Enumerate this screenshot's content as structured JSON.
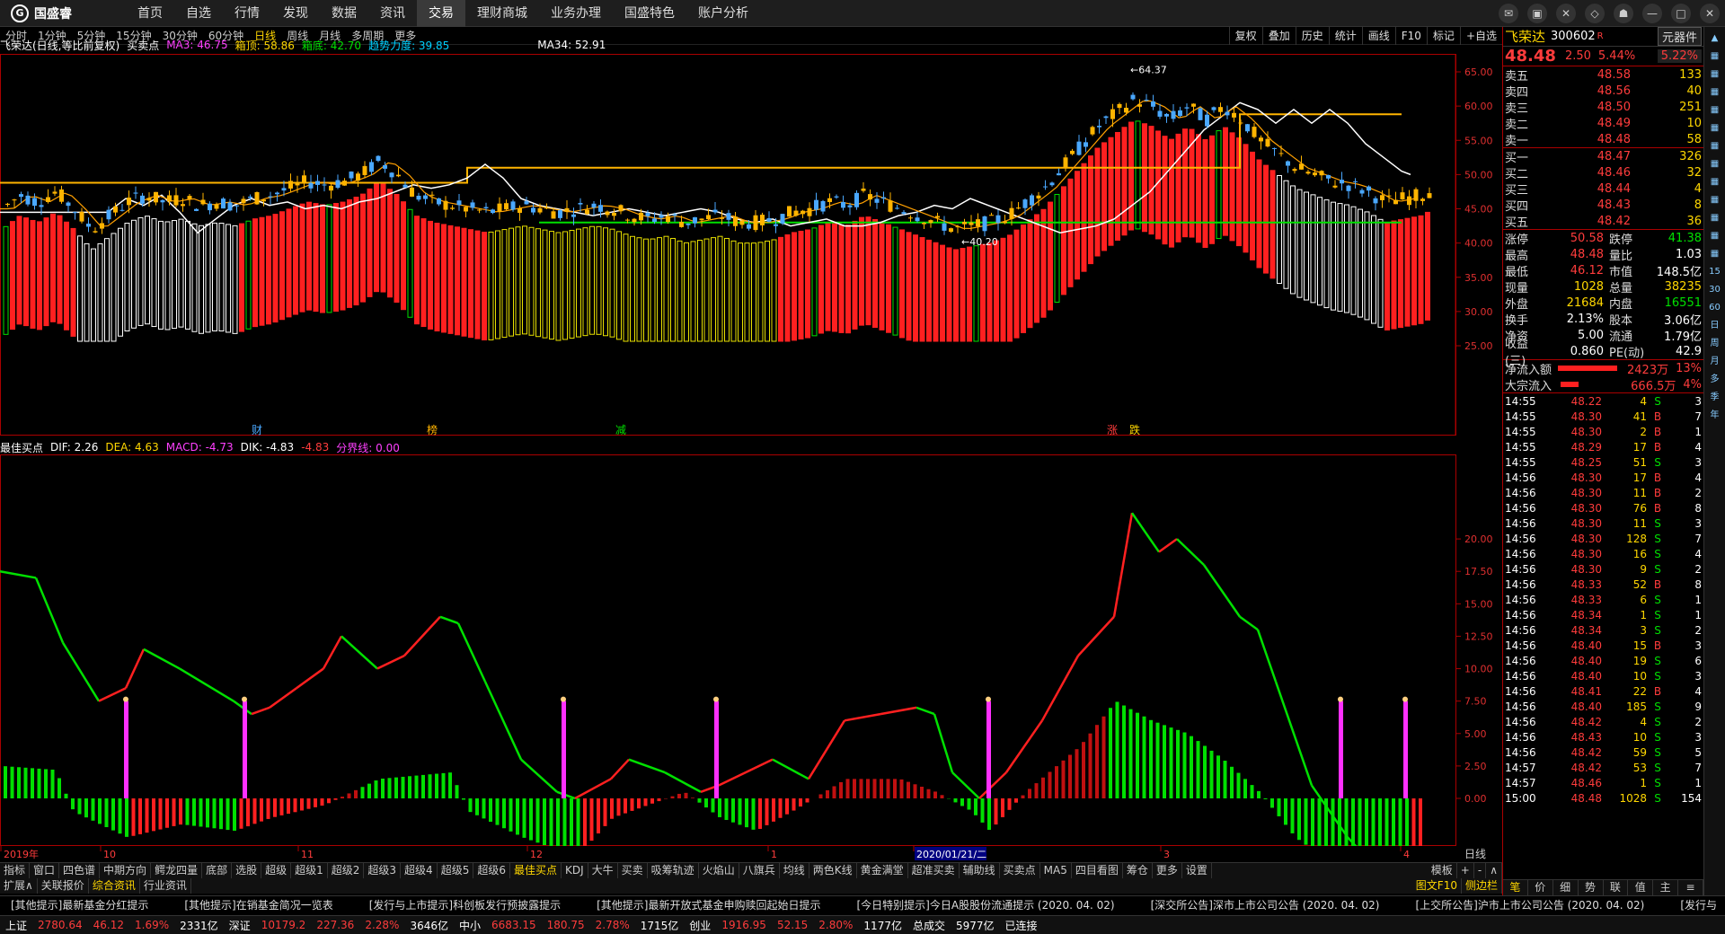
{
  "app": {
    "logo": "国盛睿"
  },
  "menu": [
    "首页",
    "自选",
    "行情",
    "发现",
    "数据",
    "资讯",
    "交易",
    "理财商城",
    "业务办理",
    "国盛特色",
    "账户分析"
  ],
  "menu_active": "交易",
  "periods": [
    "分时",
    "1分钟",
    "5分钟",
    "15分钟",
    "30分钟",
    "60分钟",
    "日线",
    "周线",
    "月线",
    "多周期",
    "更多"
  ],
  "period_active": "日线",
  "chart_tools": [
    "复权",
    "叠加",
    "历史",
    "统计",
    "画线",
    "F10",
    "标记",
    "+自选"
  ],
  "main_indicator": {
    "title": "飞荣达(日线,等比前复权)",
    "name": "买卖点",
    "ma3": "MA3: 46.75",
    "box_top": "箱顶: 58.86",
    "box_bottom": "箱底: 42.70",
    "trend": "趋势力度: 39.85",
    "ma34": "MA34: 52.91"
  },
  "price_axis": [
    "65.00",
    "60.00",
    "55.00",
    "50.00",
    "45.00",
    "40.00",
    "35.00",
    "30.00",
    "25.00"
  ],
  "price_annotations": {
    "high_label": "64.37",
    "low_label": "40.20"
  },
  "event_marks": [
    "财",
    "榜",
    "减",
    "涨",
    "跌"
  ],
  "sub_indicator": {
    "name": "最佳买点",
    "dif": "DIF: 2.26",
    "dea": "DEA: 4.63",
    "macd": "MACD: -4.73",
    "dik": "DIK: -4.83",
    "dik2": "-4.83",
    "line": "分界线: 0.00"
  },
  "macd_axis": [
    "20.00",
    "17.50",
    "15.00",
    "12.50",
    "10.00",
    "7.50",
    "5.00",
    "2.50",
    "0.00"
  ],
  "date_axis": [
    "2019年",
    "10",
    "11",
    "12",
    "1",
    "2020/01/21/二",
    "3",
    "4"
  ],
  "date_axis_right": "日线",
  "tabs_row1": [
    "指标",
    "窗口",
    "四色谱",
    "中期方向",
    "鳄龙四量",
    "底部",
    "选股",
    "超级",
    "超级1",
    "超级2",
    "超级3",
    "超级4",
    "超级5",
    "超级6",
    "最佳买点",
    "KDJ",
    "大牛",
    "买卖",
    "吸筹轨迹",
    "火焰山",
    "八旗兵",
    "均线",
    "两色K线",
    "黄金满堂",
    "超准买卖",
    "辅助线",
    "买卖点",
    "MA5",
    "四目看图",
    "筹仓",
    "更多",
    "设置"
  ],
  "tabs_row1_active": "最佳买点",
  "tabs_row1_right": [
    "模板",
    "+",
    "-",
    "∧"
  ],
  "tabs_row2": [
    "扩展∧",
    "关联报价",
    "综合资讯",
    "行业资讯"
  ],
  "tabs_row2_active": "综合资讯",
  "tabs_row2_right": [
    "图文F10",
    "侧边栏"
  ],
  "panel_tabs": [
    "笔",
    "价",
    "细",
    "势",
    "联",
    "值",
    "主",
    "≡"
  ],
  "news": [
    "[其他提示]最新基金分红提示",
    "[其他提示]在销基金简况一览表",
    "[发行与上市提示]科创板发行预披露提示",
    "[其他提示]最新开放式基金申购赎回起始日提示",
    "[今日特别提示]今日A股股份流通提示 (2020. 04. 02)",
    "[深交所公告]深市上市公司公告 (2020. 04. 02)",
    "[上交所公告]沪市上市公司公告 (2020. 04. 02)",
    "[发行与"
  ],
  "status": {
    "sh_label": "上证",
    "sh_val": "2780.64",
    "sh_chg": "46.12",
    "sh_pct": "1.69%",
    "sh_amt": "2331亿",
    "sz_label": "深证",
    "sz_val": "10179.2",
    "sz_chg": "227.36",
    "sz_pct": "2.28%",
    "sz_amt": "3646亿",
    "zx_label": "中小",
    "zx_val": "6683.15",
    "zx_chg": "180.75",
    "zx_pct": "2.78%",
    "zx_amt": "1715亿",
    "cy_label": "创业",
    "cy_val": "1916.95",
    "cy_chg": "52.15",
    "cy_pct": "2.80%",
    "cy_amt": "1177亿",
    "total_label": "总成交",
    "total_val": "5977亿",
    "conn": "已连接"
  },
  "stock": {
    "name": "飞荣达",
    "code": "300602",
    "flag": "R",
    "component_btn": "元器件",
    "price": "48.48",
    "change": "2.50",
    "pct": "5.44%",
    "component_pct": "5.22%"
  },
  "asks": [
    {
      "label": "卖五",
      "price": "48.58",
      "vol": "133"
    },
    {
      "label": "卖四",
      "price": "48.56",
      "vol": "40"
    },
    {
      "label": "卖三",
      "price": "48.50",
      "vol": "251"
    },
    {
      "label": "卖二",
      "price": "48.49",
      "vol": "10"
    },
    {
      "label": "卖一",
      "price": "48.48",
      "vol": "58"
    }
  ],
  "bids": [
    {
      "label": "买一",
      "price": "48.47",
      "vol": "326"
    },
    {
      "label": "买二",
      "price": "48.46",
      "vol": "32"
    },
    {
      "label": "买三",
      "price": "48.44",
      "vol": "4"
    },
    {
      "label": "买四",
      "price": "48.43",
      "vol": "8"
    },
    {
      "label": "买五",
      "price": "48.42",
      "vol": "36"
    }
  ],
  "quote": [
    {
      "l1": "涨停",
      "v1": "50.58",
      "l2": "跌停",
      "v2": "41.38"
    },
    {
      "l1": "最高",
      "v1": "48.48",
      "l2": "量比",
      "v2": "1.03"
    },
    {
      "l1": "最低",
      "v1": "46.12",
      "l2": "市值",
      "v2": "148.5亿"
    },
    {
      "l1": "现量",
      "v1": "1028",
      "l2": "总量",
      "v2": "38235"
    },
    {
      "l1": "外盘",
      "v1": "21684",
      "l2": "内盘",
      "v2": "16551"
    },
    {
      "l1": "换手",
      "v1": "2.13%",
      "l2": "股本",
      "v2": "3.06亿"
    },
    {
      "l1": "净资",
      "v1": "5.00",
      "l2": "流通",
      "v2": "1.79亿"
    },
    {
      "l1": "收益(三)",
      "v1": "0.860",
      "l2": "PE(动)",
      "v2": "42.9"
    }
  ],
  "flows": [
    {
      "label": "净流入额",
      "value": "2423万",
      "pct": "13%"
    },
    {
      "label": "大宗流入",
      "value": "666.5万",
      "pct": "4%"
    }
  ],
  "ticks": [
    [
      "14:55",
      "48.22",
      "4",
      "S",
      "3"
    ],
    [
      "14:55",
      "48.30",
      "41",
      "B",
      "7"
    ],
    [
      "14:55",
      "48.30",
      "2",
      "B",
      "1"
    ],
    [
      "14:55",
      "48.29",
      "17",
      "B",
      "4"
    ],
    [
      "14:55",
      "48.25",
      "51",
      "S",
      "3"
    ],
    [
      "14:56",
      "48.30",
      "17",
      "B",
      "4"
    ],
    [
      "14:56",
      "48.30",
      "11",
      "B",
      "2"
    ],
    [
      "14:56",
      "48.30",
      "76",
      "B",
      "8"
    ],
    [
      "14:56",
      "48.30",
      "11",
      "S",
      "3"
    ],
    [
      "14:56",
      "48.30",
      "128",
      "S",
      "7"
    ],
    [
      "14:56",
      "48.30",
      "16",
      "S",
      "4"
    ],
    [
      "14:56",
      "48.30",
      "9",
      "S",
      "2"
    ],
    [
      "14:56",
      "48.33",
      "52",
      "B",
      "8"
    ],
    [
      "14:56",
      "48.33",
      "6",
      "S",
      "1"
    ],
    [
      "14:56",
      "48.34",
      "1",
      "S",
      "1"
    ],
    [
      "14:56",
      "48.34",
      "3",
      "S",
      "2"
    ],
    [
      "14:56",
      "48.40",
      "15",
      "B",
      "3"
    ],
    [
      "14:56",
      "48.40",
      "19",
      "S",
      "6"
    ],
    [
      "14:56",
      "48.40",
      "10",
      "S",
      "3"
    ],
    [
      "14:56",
      "48.41",
      "22",
      "B",
      "4"
    ],
    [
      "14:56",
      "48.40",
      "185",
      "S",
      "9"
    ],
    [
      "14:56",
      "48.42",
      "4",
      "S",
      "2"
    ],
    [
      "14:56",
      "48.43",
      "10",
      "S",
      "3"
    ],
    [
      "14:56",
      "48.42",
      "59",
      "S",
      "5"
    ],
    [
      "14:57",
      "48.42",
      "53",
      "S",
      "7"
    ],
    [
      "14:57",
      "48.46",
      "1",
      "S",
      "1"
    ],
    [
      "15:00",
      "48.48",
      "1028",
      "S",
      "154"
    ]
  ],
  "side_tools": [
    "15",
    "30",
    "60",
    "日",
    "周",
    "月",
    "多",
    "季",
    "年"
  ],
  "colors": {
    "up": "#ff3c3c",
    "down": "#00e000",
    "gold": "#ffb400",
    "magenta": "#ff40ff",
    "bg": "#000000"
  }
}
